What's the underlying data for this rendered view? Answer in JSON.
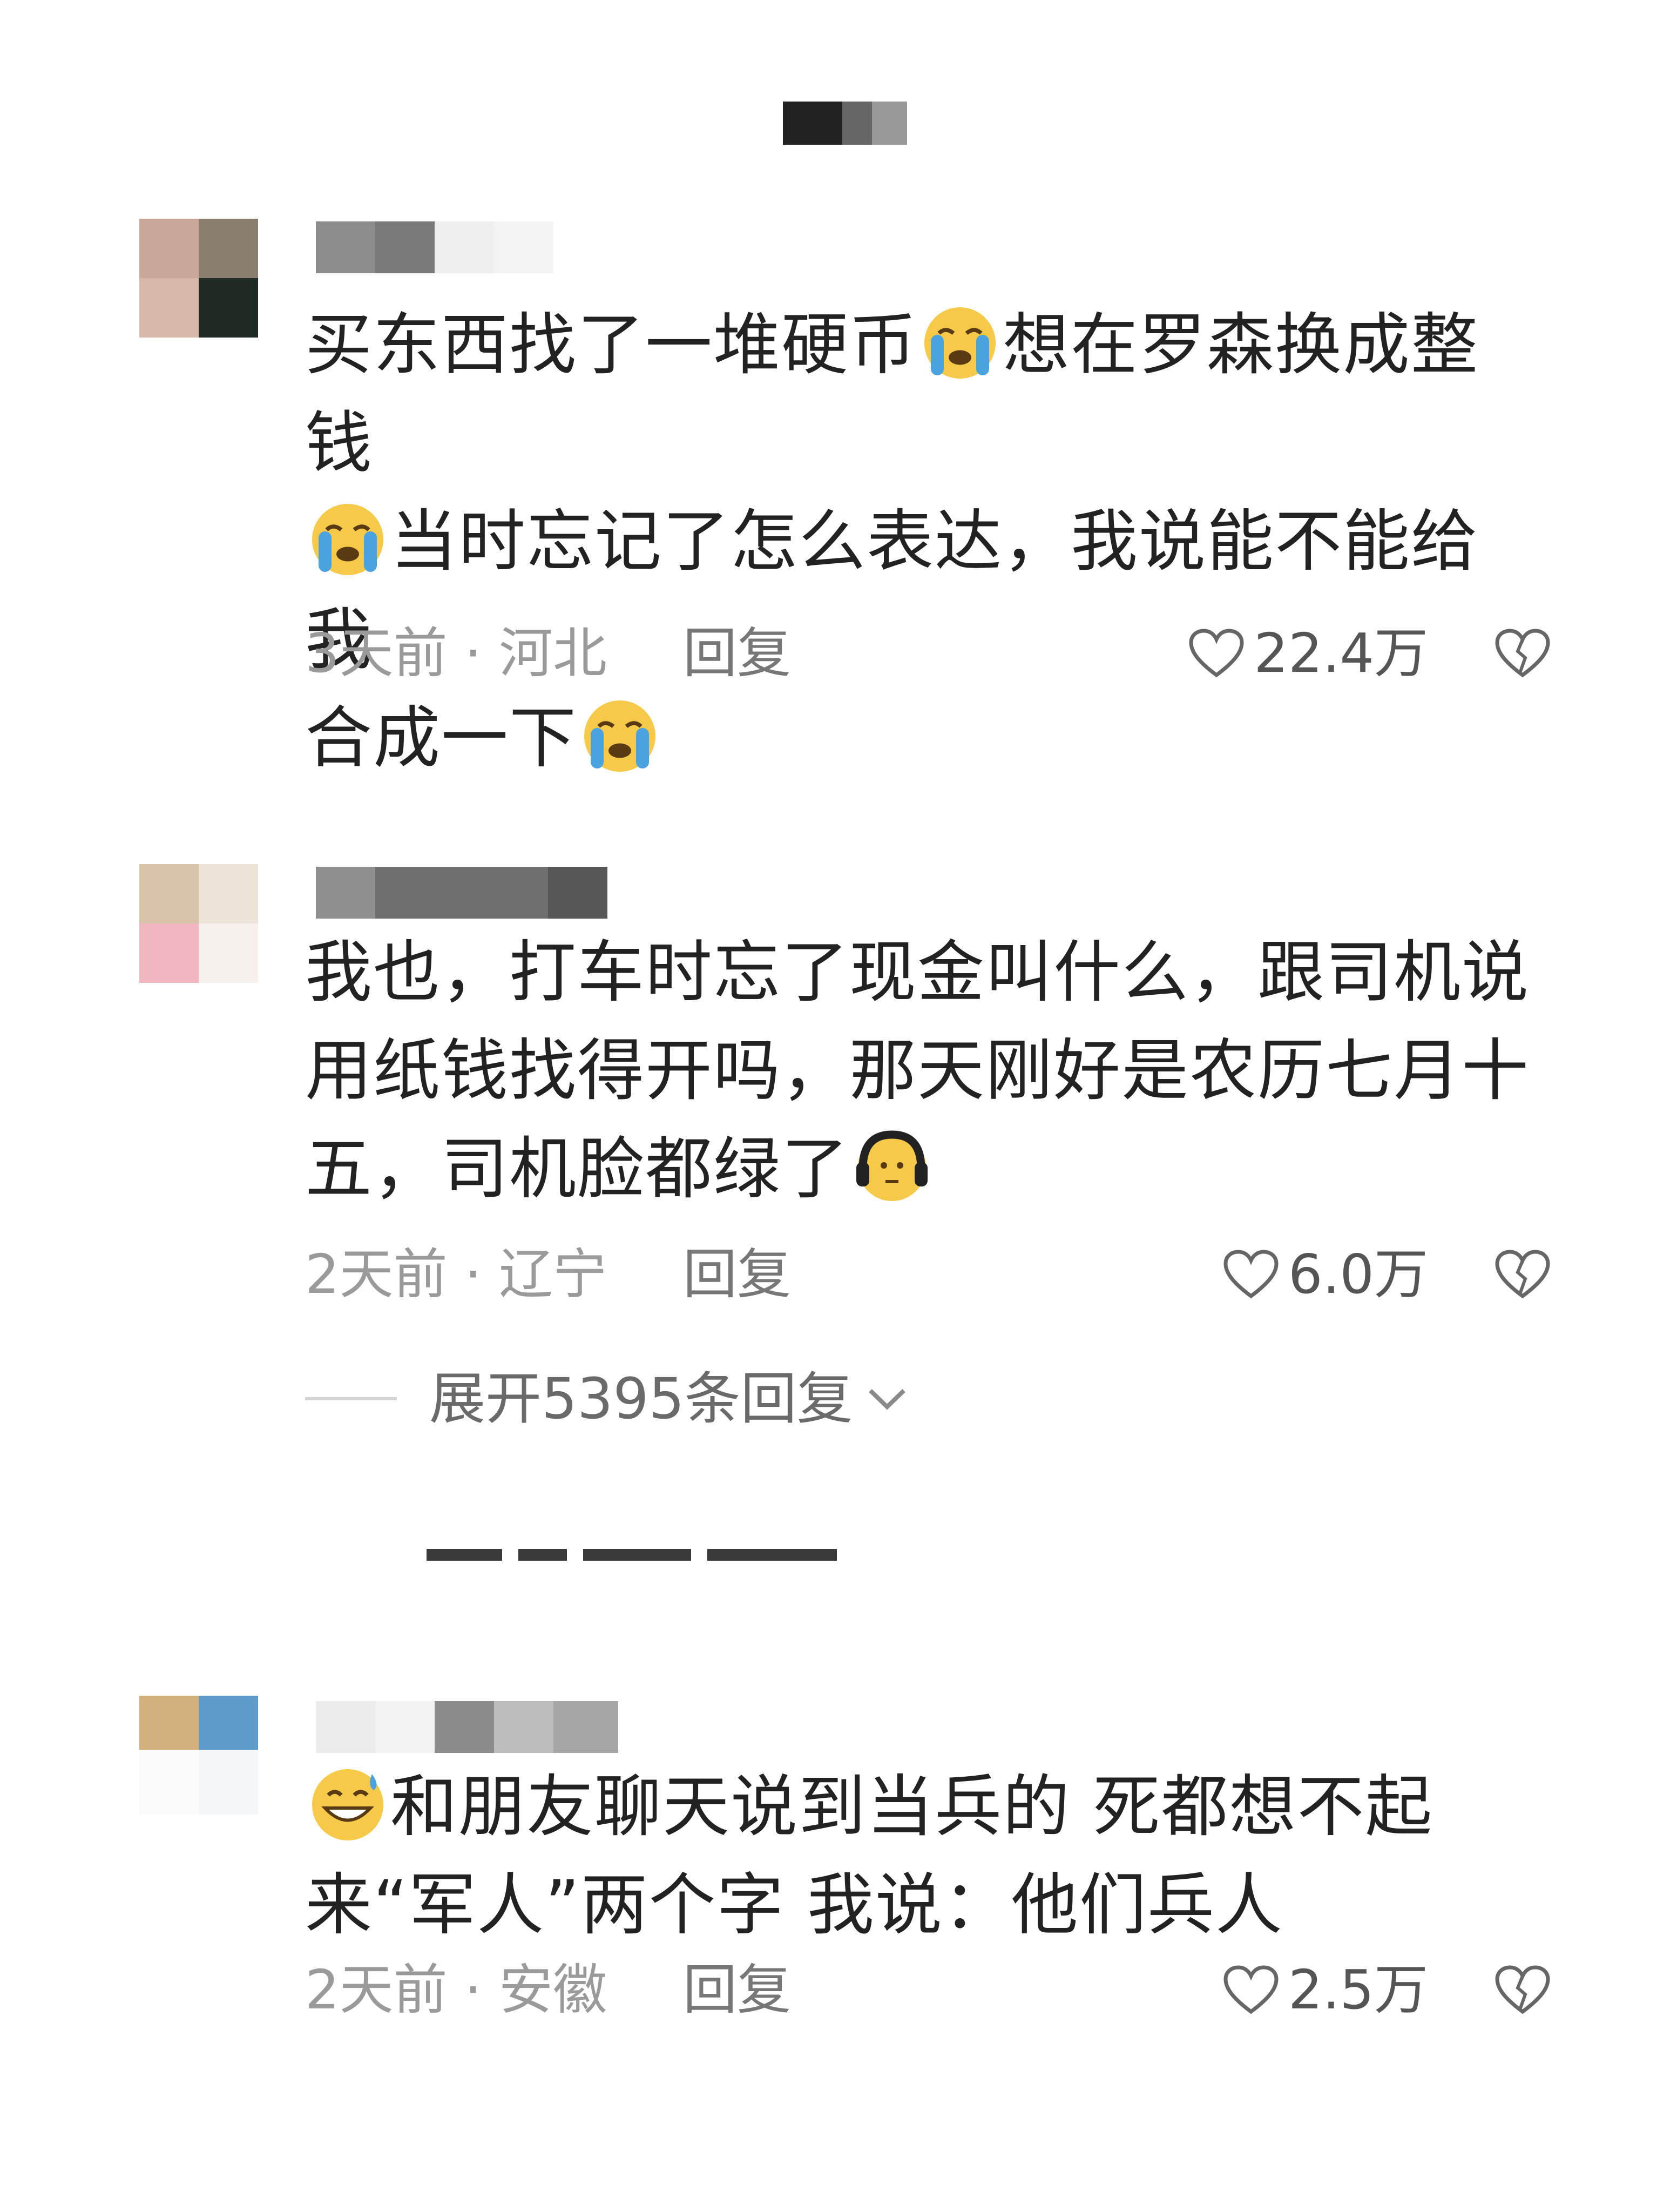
{
  "comments": [
    {
      "text_parts": [
        "买东西找了一堆硬币",
        "想在罗森换成整钱",
        "当时忘记了怎么表达，我说能不能给我",
        "合成一下",
        ""
      ],
      "emojis": [
        "loudly-crying-face-emoji",
        "loudly-crying-face-emoji",
        "loudly-crying-face-emoji"
      ],
      "time_location": "3天前 · 河北",
      "reply_label": "回复",
      "like_count": "22.4万"
    },
    {
      "text_parts": [
        "我也，打车时忘了现金叫什么，跟司机说用纸钱找得开吗，那天刚好是农历七月十五，司机脸都绿了",
        ""
      ],
      "emojis": [
        "headphone-face-emoji"
      ],
      "time_location": "2天前 · 辽宁",
      "reply_label": "回复",
      "like_count": "6.0万",
      "expand_label": "展开5395条回复"
    },
    {
      "text_parts": [
        "",
        "和朋友聊天说到当兵的 死都想不起来“军人”两个字 我说：他们兵人"
      ],
      "emojis": [
        "grinning-sweat-face-emoji"
      ],
      "time_location": "2天前 · 安徽",
      "reply_label": "回复",
      "like_count": "2.5万"
    }
  ],
  "colors": {
    "meta_text": "#9a9a9a",
    "body_text": "#222222",
    "emoji_yellow": "#f7c948",
    "emoji_tear": "#4aa3e0"
  }
}
